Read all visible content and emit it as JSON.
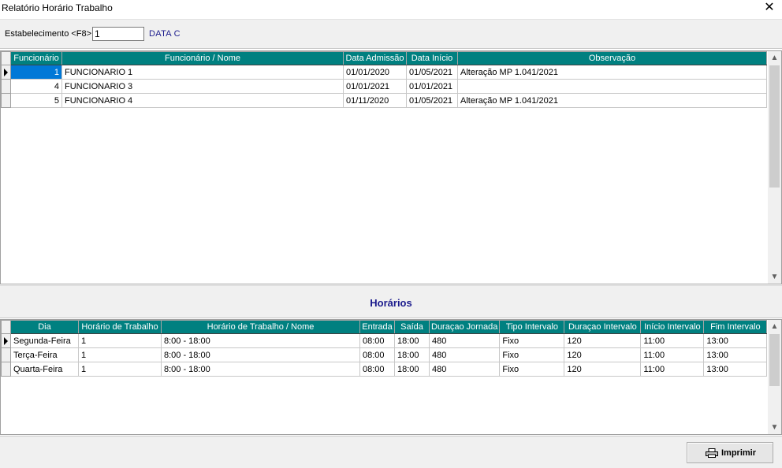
{
  "window": {
    "title": "Relatório Horário Trabalho",
    "close_glyph": "✕"
  },
  "toolbar": {
    "establishment_label": "Estabelecimento <F8>",
    "establishment_value": "1",
    "establishment_name": "DATA C"
  },
  "employees": {
    "columns": [
      "Funcionário",
      "Funcionário / Nome",
      "Data Admissão",
      "Data Início",
      "Observação"
    ],
    "rows": [
      {
        "id": "1",
        "name": "FUNCIONARIO 1",
        "admission": "01/01/2020",
        "start": "01/05/2021",
        "note": "Alteração MP 1.041/2021"
      },
      {
        "id": "4",
        "name": "FUNCIONARIO 3",
        "admission": "01/01/2021",
        "start": "01/01/2021",
        "note": ""
      },
      {
        "id": "5",
        "name": "FUNCIONARIO 4",
        "admission": "01/11/2020",
        "start": "01/05/2021",
        "note": "Alteração MP 1.041/2021"
      }
    ]
  },
  "schedules_section": {
    "title": "Horários"
  },
  "schedules": {
    "columns": [
      "Dia",
      "Horário de Trabalho",
      "Horário de Trabalho / Nome",
      "Entrada",
      "Saída",
      "Duraçao Jornada",
      "Tipo Intervalo",
      "Duraçao Intervalo",
      "Início Intervalo",
      "Fim Intervalo"
    ],
    "rows": [
      {
        "day": "Segunda-Feira",
        "code": "1",
        "name": "8:00 - 18:00",
        "in": "08:00",
        "out": "18:00",
        "duration": "480",
        "break_type": "Fixo",
        "break_duration": "120",
        "break_start": "11:00",
        "break_end": "13:00"
      },
      {
        "day": "Terça-Feira",
        "code": "1",
        "name": "8:00 - 18:00",
        "in": "08:00",
        "out": "18:00",
        "duration": "480",
        "break_type": "Fixo",
        "break_duration": "120",
        "break_start": "11:00",
        "break_end": "13:00"
      },
      {
        "day": "Quarta-Feira",
        "code": "1",
        "name": "8:00 - 18:00",
        "in": "08:00",
        "out": "18:00",
        "duration": "480",
        "break_type": "Fixo",
        "break_duration": "120",
        "break_start": "11:00",
        "break_end": "13:00"
      }
    ]
  },
  "footer": {
    "print_label": "Imprimir"
  },
  "icons": {
    "close": "close-icon",
    "print": "printer-icon",
    "row_pointer": "row-pointer-icon"
  },
  "colors": {
    "header_bg": "#008080",
    "selection": "#0078d7",
    "accent_text": "#1a1a8c"
  }
}
